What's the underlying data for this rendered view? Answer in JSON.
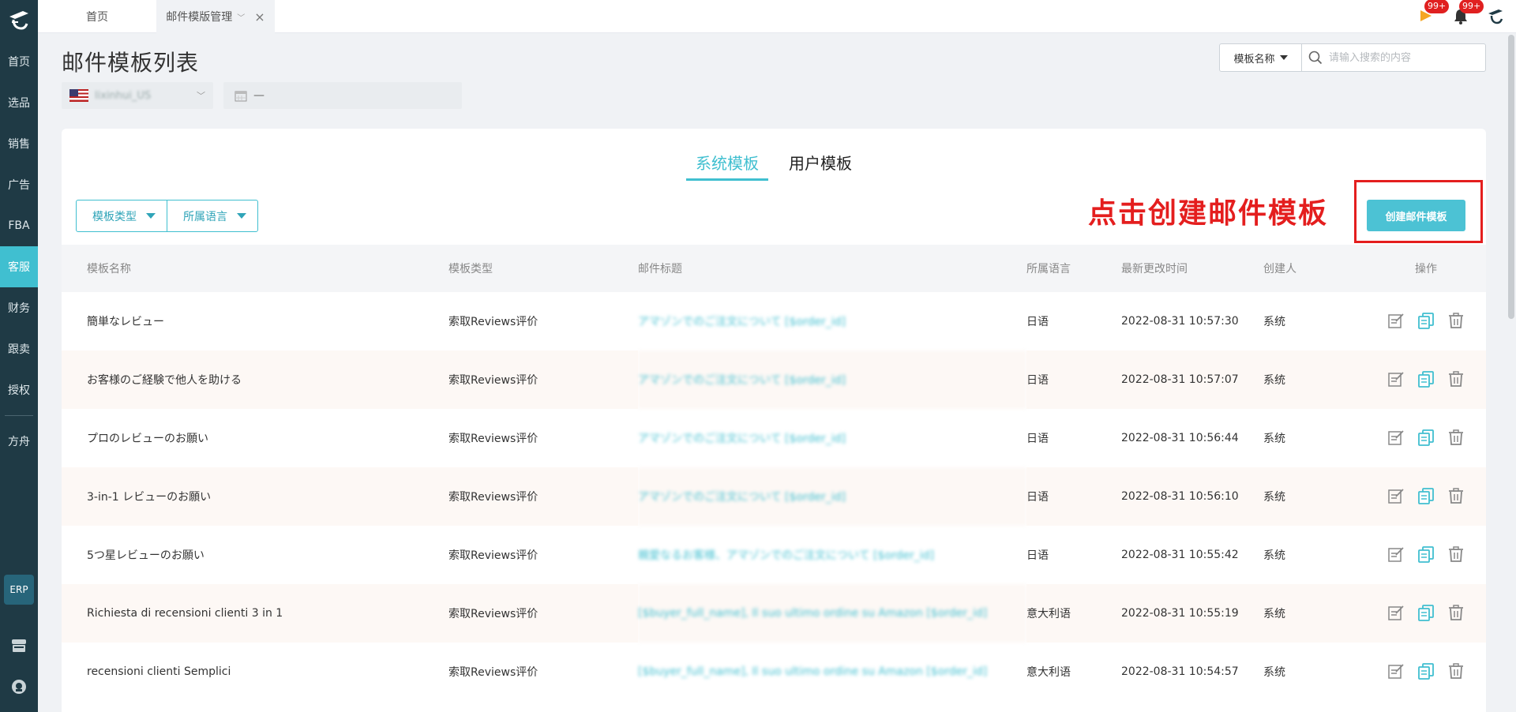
{
  "sidebar": {
    "items": [
      {
        "label": "首页"
      },
      {
        "label": "选品"
      },
      {
        "label": "销售"
      },
      {
        "label": "广告"
      },
      {
        "label": "FBA"
      },
      {
        "label": "客服"
      },
      {
        "label": "财务"
      },
      {
        "label": "跟卖"
      },
      {
        "label": "授权"
      }
    ],
    "extra_item": "方舟",
    "erp_label": "ERP",
    "active_index": 5
  },
  "topbar": {
    "tabs": [
      {
        "label": "首页"
      },
      {
        "label": "邮件模版管理"
      }
    ],
    "notifications": {
      "flag_count": "99+",
      "bell_count": "99+"
    }
  },
  "page": {
    "title": "邮件模板列表",
    "store_selector": "lixinhui_US",
    "date_range": "—"
  },
  "search": {
    "type_label": "模板名称",
    "placeholder": "请输入搜索的内容"
  },
  "card": {
    "tabs": [
      {
        "label": "系统模板",
        "active": true
      },
      {
        "label": "用户模板",
        "active": false
      }
    ],
    "filters": [
      {
        "label": "模板类型"
      },
      {
        "label": "所属语言"
      }
    ],
    "annotation": "点击创建邮件模板",
    "create_button": "创建邮件模板",
    "columns": [
      "模板名称",
      "模板类型",
      "邮件标题",
      "所属语言",
      "最新更改时间",
      "创建人",
      "操作"
    ],
    "rows": [
      {
        "name": "簡単なレビュー",
        "type": "索取Reviews评价",
        "title": "アマゾンでのご注文について [$order_id]",
        "lang": "日语",
        "time": "2022-08-31 10:57:30",
        "creator": "系统"
      },
      {
        "name": "お客様のご経験で他人を助ける",
        "type": "索取Reviews评价",
        "title": "アマゾンでのご注文について [$order_id]",
        "lang": "日语",
        "time": "2022-08-31 10:57:07",
        "creator": "系统"
      },
      {
        "name": "プロのレビューのお願い",
        "type": "索取Reviews评价",
        "title": "アマゾンでのご注文について [$order_id]",
        "lang": "日语",
        "time": "2022-08-31 10:56:44",
        "creator": "系统"
      },
      {
        "name": "3-in-1 レビューのお願い",
        "type": "索取Reviews评价",
        "title": "アマゾンでのご注文について [$order_id]",
        "lang": "日语",
        "time": "2022-08-31 10:56:10",
        "creator": "系统"
      },
      {
        "name": "5つ星レビューのお願い",
        "type": "索取Reviews评价",
        "title": "親愛なるお客様、アマゾンでのご注文について [$order_id]",
        "lang": "日语",
        "time": "2022-08-31 10:55:42",
        "creator": "系统"
      },
      {
        "name": "Richiesta di recensioni clienti 3 in 1",
        "type": "索取Reviews评价",
        "title": "[$buyer_full_name], Il suo ultimo ordine su Amazon [$order_id]",
        "lang": "意大利语",
        "time": "2022-08-31 10:55:19",
        "creator": "系统"
      },
      {
        "name": "recensioni clienti Semplici",
        "type": "索取Reviews评价",
        "title": "[$buyer_full_name], Il suo ultimo ordine su Amazon [$order_id]",
        "lang": "意大利语",
        "time": "2022-08-31 10:54:57",
        "creator": "系统"
      }
    ]
  },
  "colors": {
    "accent": "#40bfd0",
    "sidebar_bg": "#1f3a45",
    "annotation_red": "#e41e1e",
    "badge_red": "#e02020"
  }
}
